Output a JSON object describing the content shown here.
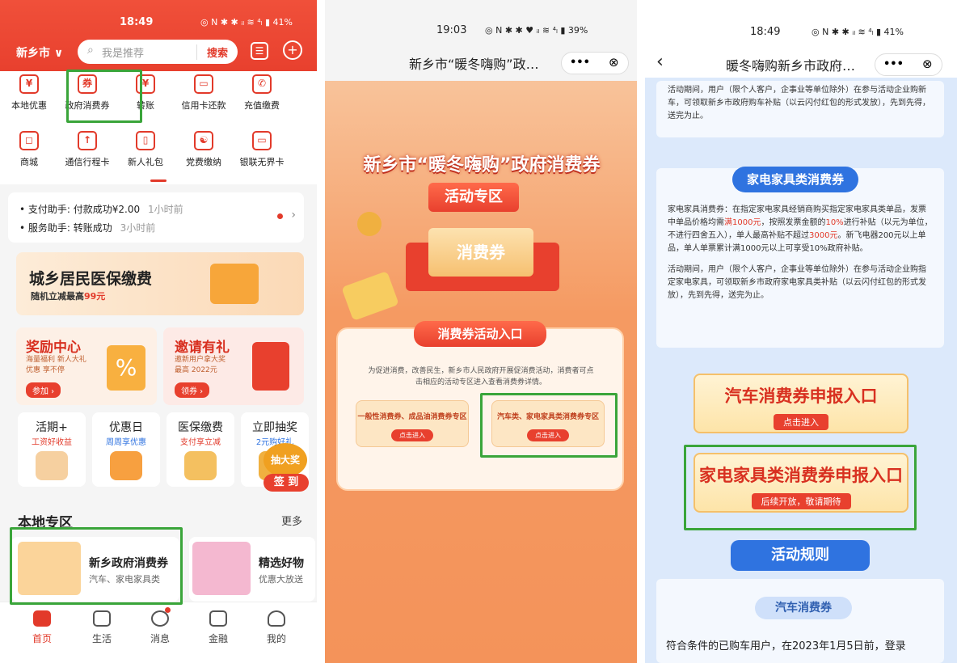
{
  "s1": {
    "time": "18:49",
    "status": "◎ N ✱ ✱ ᵢₗ ≋ ⁴ₗ ▮ 41%",
    "city": "新乡市 ∨",
    "search_ph": "我是推荐",
    "search_btn": "搜索",
    "icons": [
      "本地优惠",
      "政府消费券",
      "转账",
      "信用卡还款",
      "充值缴费",
      "商城",
      "通信行程卡",
      "新人礼包",
      "党费缴纳",
      "银联无界卡"
    ],
    "icon_glyphs": [
      "¥",
      "券",
      "¥",
      "▭",
      "✆",
      "◻",
      "↑",
      "▯",
      "☯",
      "▭"
    ],
    "notice1": "• 支付助手: 付款成功¥2.00",
    "notice1_t": "1小时前",
    "notice2": "• 服务助手: 转账成功",
    "notice2_t": "3小时前",
    "banner_title": "城乡居民医保缴费",
    "banner_sub_a": "随机立减最高",
    "banner_sub_b": "99元",
    "reward_title": "奖励中心",
    "reward_sub": "海量福利 新人大礼\n优惠 享不停",
    "reward_btn": "参加 ›",
    "invite_title": "邀请有礼",
    "invite_sub": "邀新用户拿大奖\n最高 2022元",
    "invite_btn": "领券 ›",
    "tiles": [
      {
        "t": "活期+",
        "s": "工资好收益"
      },
      {
        "t": "优惠日",
        "s": "周周享优惠"
      },
      {
        "t": "医保缴费",
        "s": "支付享立减"
      },
      {
        "t": "立即抽奖",
        "s": "2元购好礼"
      }
    ],
    "draw_badge": "抽大奖",
    "sign": "签 到",
    "local_title": "本地专区",
    "local_more": "更多",
    "local1_t": "新乡政府消费券",
    "local1_s": "汽车、家电家具类",
    "local2_t": "精选好物",
    "local2_s": "优惠大放送",
    "nav": [
      "首页",
      "生活",
      "消息",
      "金融",
      "我的"
    ]
  },
  "s2": {
    "time": "19:03",
    "status": "◎ N ✱ ✱ ♥ ᵢₗ ≋ ⁴ₗ ▮ 39%",
    "title": "新乡市“暖冬嗨购”政…",
    "more": "•••",
    "close": "⊗",
    "hero": "新乡市“暖冬嗨购”政府消费券",
    "zone_btn": "活动专区",
    "coupon": "消费券",
    "entry_title": "消费券活动入口",
    "desc": "为促进消费，改善民生，新乡市人民政府开展促消费活动，消费者可点击相应的活动专区进入查看消费券详情。",
    "mini1": "一般性消费券、成品油消费券专区",
    "mini2": "汽车类、家电家具类消费券专区",
    "mini_btn": "点击进入"
  },
  "s3": {
    "time": "18:49",
    "status": "◎ N ✱ ✱ ᵢₗ ≋ ⁴ₗ ▮ 41%",
    "back": "‹",
    "title": "暖冬嗨购新乡市政府…",
    "more": "•••",
    "close": "⊗",
    "top_text": "活动期间，用户（限个人客户，企事业等单位除外）在参与活动企业购新车，可领取新乡市政府购车补贴（以云闪付红包的形式发放），先到先得，送完为止。",
    "tag1": "家电家具类消费券",
    "p1a": "家电家具消费券：在指定家电家具经销商购买指定家电家具类单品，发票中单品价格均需",
    "p1b": "满1000元",
    "p1c": "，按照发票金额的",
    "p1d": "10%",
    "p1e": "进行补贴（以元为单位，不进行四舍五入），单人最高补贴不超过",
    "p1f": "3000元",
    "p1g": "。新飞电器200元以上单品，单人单票累计满1000元以上可享受10%政府补贴。",
    "p2": "活动期间，用户（限个人客户，企事业等单位除外）在参与活动企业购指定家电家具，可领取新乡市政府家电家具类补贴（以云闪付红包的形式发放），先到先得，送完为止。",
    "entry1": "汽车消费券申报入口",
    "entry1_btn": "点击进入",
    "entry2": "家电家具类消费券申报入口",
    "entry2_btn": "后续开放，敬请期待",
    "rules": "活动规则",
    "tag2": "汽车消费券",
    "bottom": "符合条件的已购车用户，在2023年1月5日前，登录"
  },
  "colors": {
    "accent": "#e23a2a",
    "green_frame": "#3aa53a",
    "blue": "#2f73e0"
  }
}
